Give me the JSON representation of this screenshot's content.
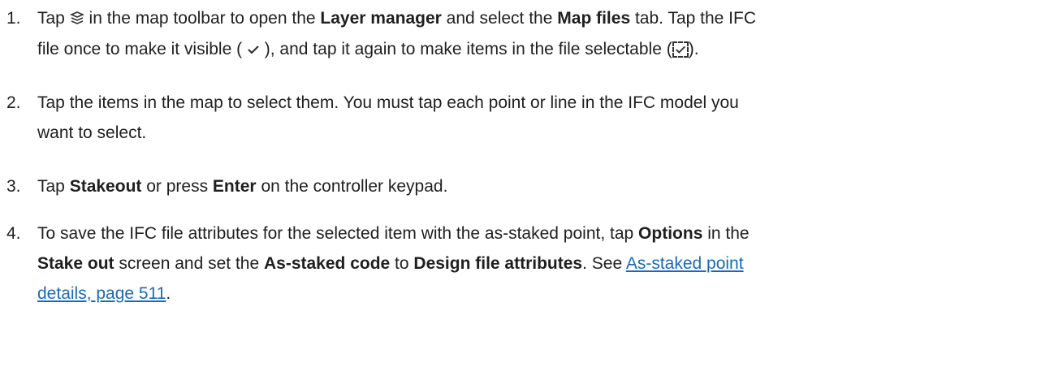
{
  "steps": [
    {
      "num": "1.",
      "lines": [
        [
          {
            "t": "Tap "
          },
          {
            "icon": "layers-icon"
          },
          {
            "t": " in the map toolbar to open the "
          },
          {
            "b": "Layer manager"
          },
          {
            "t": " and select the "
          },
          {
            "b": "Map files"
          },
          {
            "t": " tab. Tap the IFC"
          }
        ],
        [
          {
            "t": "file once to make it visible ( "
          },
          {
            "icon": "checkmark-icon"
          },
          {
            "t": " ), and tap it again to make items in the file selectable ("
          },
          {
            "icon": "checkmark-selectable-icon"
          },
          {
            "t": ")."
          }
        ]
      ]
    },
    {
      "num": "2.",
      "lines": [
        [
          {
            "t": "Tap the items in the map to select them. You must tap each point or line in the IFC model you"
          }
        ],
        [
          {
            "t": "want to select."
          }
        ]
      ]
    },
    {
      "num": "3.",
      "lines": [
        [
          {
            "t": "Tap "
          },
          {
            "b": "Stakeout"
          },
          {
            "t": " or press "
          },
          {
            "b": "Enter"
          },
          {
            "t": " on the controller keypad."
          }
        ]
      ]
    },
    {
      "num": "4.",
      "lines": [
        [
          {
            "t": "To save the IFC file attributes for the selected item with the as-staked point, tap "
          },
          {
            "b": "Options"
          },
          {
            "t": " in the"
          }
        ],
        [
          {
            "b": "Stake out"
          },
          {
            "t": " screen and set the "
          },
          {
            "b": "As-staked code"
          },
          {
            "t": " to "
          },
          {
            "b": "Design file attributes"
          },
          {
            "t": ". See "
          },
          {
            "link": "As-staked point"
          }
        ],
        [
          {
            "link": "details, page 511"
          },
          {
            "t": "."
          }
        ]
      ]
    }
  ]
}
